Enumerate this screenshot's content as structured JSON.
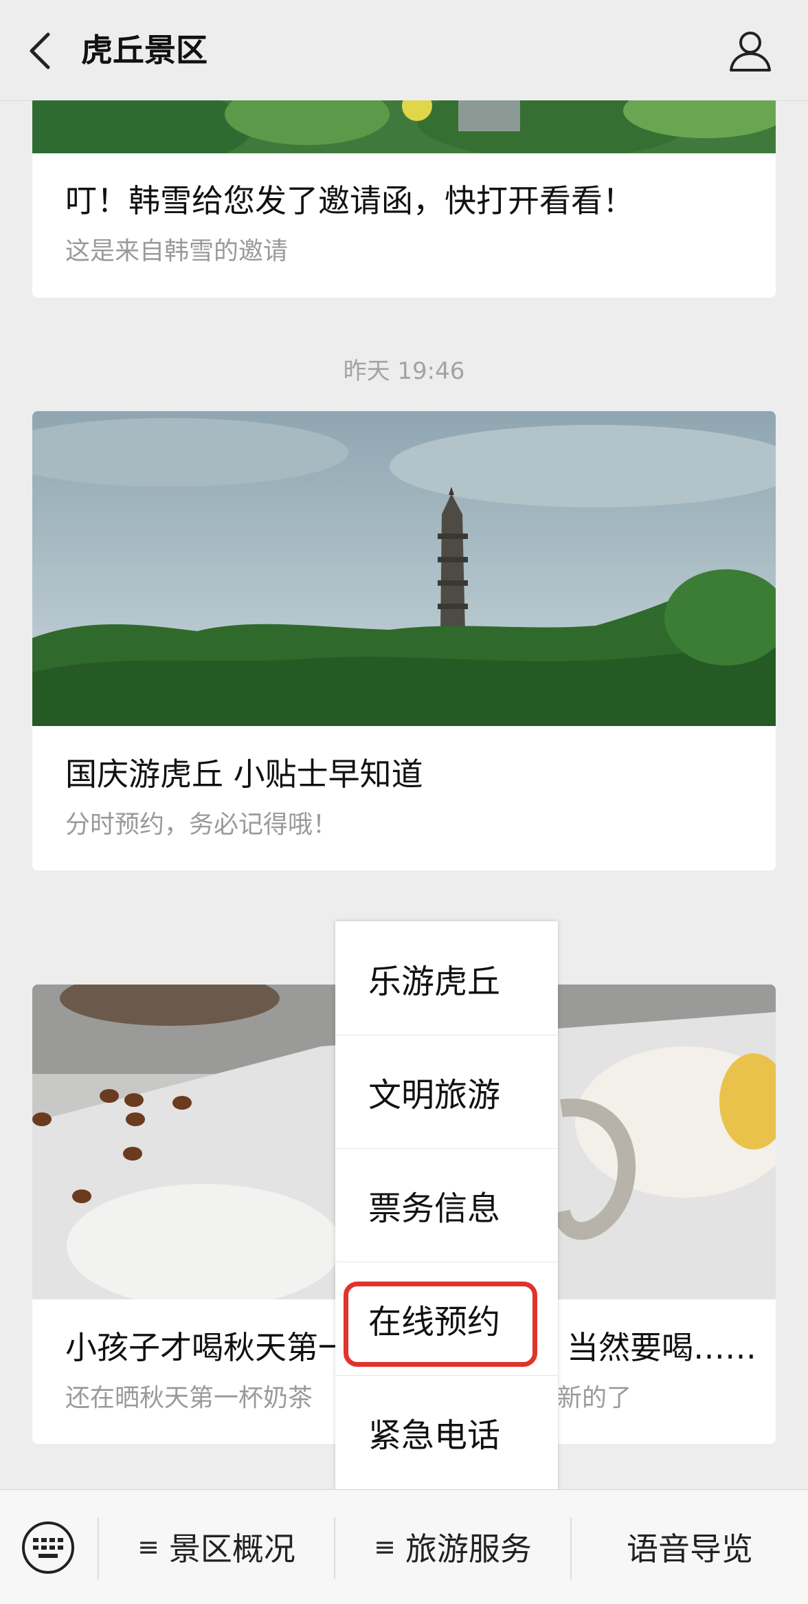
{
  "header": {
    "title": "虎丘景区",
    "back_icon": "chevron-left-icon",
    "profile_icon": "person-icon"
  },
  "cards": [
    {
      "title": "叮！韩雪给您发了邀请函，快打开看看！",
      "subtitle": "这是来自韩雪的邀请"
    },
    {
      "title": "国庆游虎丘 小贴士早知道",
      "subtitle": "分时预约，务必记得哦！"
    },
    {
      "title_left": "小孩子才喝秋天第一",
      "title_right": "，当然要喝……",
      "subtitle_left": "还在晒秋天第一杯奶茶",
      "subtitle_right": "新的了"
    }
  ],
  "timestamp": "昨天 19:46",
  "menu": {
    "items": [
      {
        "label": "乐游虎丘"
      },
      {
        "label": "文明旅游"
      },
      {
        "label": "票务信息"
      },
      {
        "label": "在线预约"
      },
      {
        "label": "紧急电话"
      }
    ],
    "highlight_color": "#e0332b"
  },
  "bottombar": {
    "keyboard_icon": "keyboard-icon",
    "tab1": "景区概况",
    "tab2": "旅游服务",
    "tab3": "语音导览",
    "menu_glyph": "≡"
  }
}
